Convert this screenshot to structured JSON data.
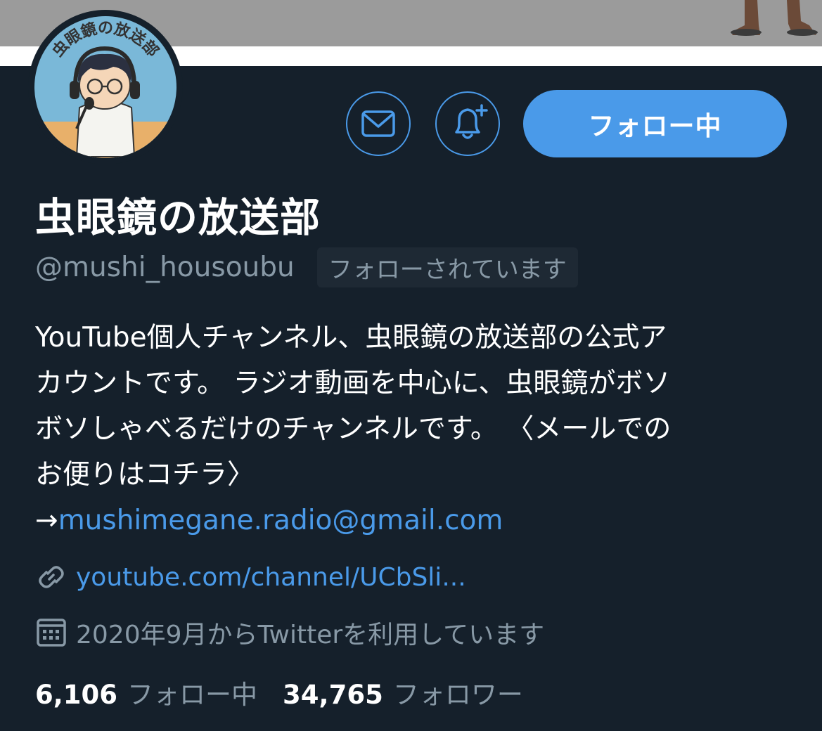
{
  "profile": {
    "display_name": "虫眼鏡の放送部",
    "handle": "@mushi_housoubu",
    "follows_you_badge": "フォローされています",
    "avatar_text": "虫眼鏡の放送部"
  },
  "actions": {
    "follow_label": "フォロー中",
    "message_icon": "mail-icon",
    "notify_icon": "bell-plus-icon"
  },
  "bio": {
    "lines": [
      "YouTube個人チャンネル、虫眼鏡の放送部の公式ア",
      "カウントです。 ラジオ動画を中心に、虫眼鏡がボソ",
      "ボソしゃべるだけのチャンネルです。 〈メールでの",
      "お便りはコチラ〉"
    ],
    "arrow": "→",
    "email": "mushimegane.radio@gmail.com"
  },
  "meta": {
    "website": "youtube.com/channel/UCbSli...",
    "joined": "2020年9月からTwitterを利用しています"
  },
  "stats": {
    "following_count": "6,106",
    "following_label": "フォロー中",
    "followers_count": "34,765",
    "followers_label": "フォロワー"
  },
  "colors": {
    "background": "#15202b",
    "accent": "#4a9ae9",
    "secondary_text": "#8899a6"
  }
}
